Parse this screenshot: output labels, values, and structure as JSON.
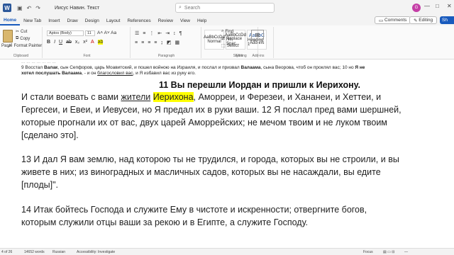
{
  "titlebar": {
    "logo": "W",
    "doc_title": "Иисус Навин. Текст",
    "search_placeholder": "Search",
    "avatar_initials": "G",
    "minimize": "—",
    "maximize": "□",
    "close": "✕"
  },
  "tabs": {
    "items": [
      "Home",
      "New Tab",
      "Insert",
      "Draw",
      "Design",
      "Layout",
      "References",
      "Review",
      "View",
      "Help"
    ],
    "comments": "Comments",
    "editing": "Editing",
    "share": "Sh"
  },
  "ribbon": {
    "paste": "Paste",
    "cut": "Cut",
    "copy": "Copy",
    "format_painter": "Format Painter",
    "clipboard_label": "Clipboard",
    "font_name": "Aptos (Body)",
    "font_size": "11",
    "font_label": "Font",
    "paragraph_label": "Paragraph",
    "styles": [
      {
        "preview": "AaBbCcDd",
        "name": "Normal"
      },
      {
        "preview": "AaBbCcDd",
        "name": "No Spac..."
      },
      {
        "preview": "AaBbC",
        "name": "Heading 1"
      }
    ],
    "styles_label": "Styles",
    "find": "Find",
    "replace": "Replace",
    "select": "Select",
    "editing_label": "Editing",
    "addins": "Add-ins",
    "addins_label": "Add-ins"
  },
  "document": {
    "top_cut": "... ... ... ... ... ... ...",
    "verse9_line1_pre": "9 Восстал ",
    "verse9_line1_b1": "Валак",
    "verse9_line1_mid": ", сын Сепфоров, царь Моавитский, и пошел войною на Израиля, и послал и призвал ",
    "verse9_line1_b2": "Валаама",
    "verse9_line1_end": ", сына Веорова, чтоб он проклял вас; 10 но ",
    "verse9_line1_b3": "Я не",
    "verse9_line2_b": "хотел послушать Валаама",
    "verse9_line2_mid": ", - и он ",
    "verse9_line2_ul": "благословил вас",
    "verse9_line2_end": ", и Я избавил вас из руку его.",
    "heading": "11 Вы перешли Иордан и пришли к Иерихону.",
    "p1_l1_a": "И стали воевать с вами ",
    "p1_l1_ul": "жители",
    "p1_l1_hl": "Иерихона",
    "p1_l1_b": ", Аморреи, и Ферезеи, и Хананеи, и Хеттеи, и",
    "p1_l2": "Гергесеи, и Евеи, и Иевусеи, но Я предал их в руки ваши. 12 Я послал пред вами шершней,",
    "p1_l3": "которые прогнали их от вас, двух царей Аморрейских; не мечом твоим и не луком твоим",
    "p1_l4": "[сделано это].",
    "p2_l1": "13 И дал Я вам землю, над которою ты не трудился, и города, которых вы не строили, и вы",
    "p2_l2": "живете в них; из виноградных и масличных садов, которых вы не насаждали, вы едите",
    "p2_l3": "[плоды]\".",
    "p3_l1": "14 Итак бойтесь Господа и служите Ему в чистоте и искренности; отвергните богов,",
    "p3_l2": "которым служили отцы ваши за рекою и в Египте, а служите Господу."
  },
  "status": {
    "page": "4 of 26",
    "words": "14652 words",
    "language": "Russian",
    "accessibility": "Accessibility: Investigate",
    "focus": "Focus",
    "zoom": "—"
  },
  "colors": {
    "accent": "#185abd",
    "highlight": "#ffff00",
    "word_brand": "#2b579a"
  }
}
